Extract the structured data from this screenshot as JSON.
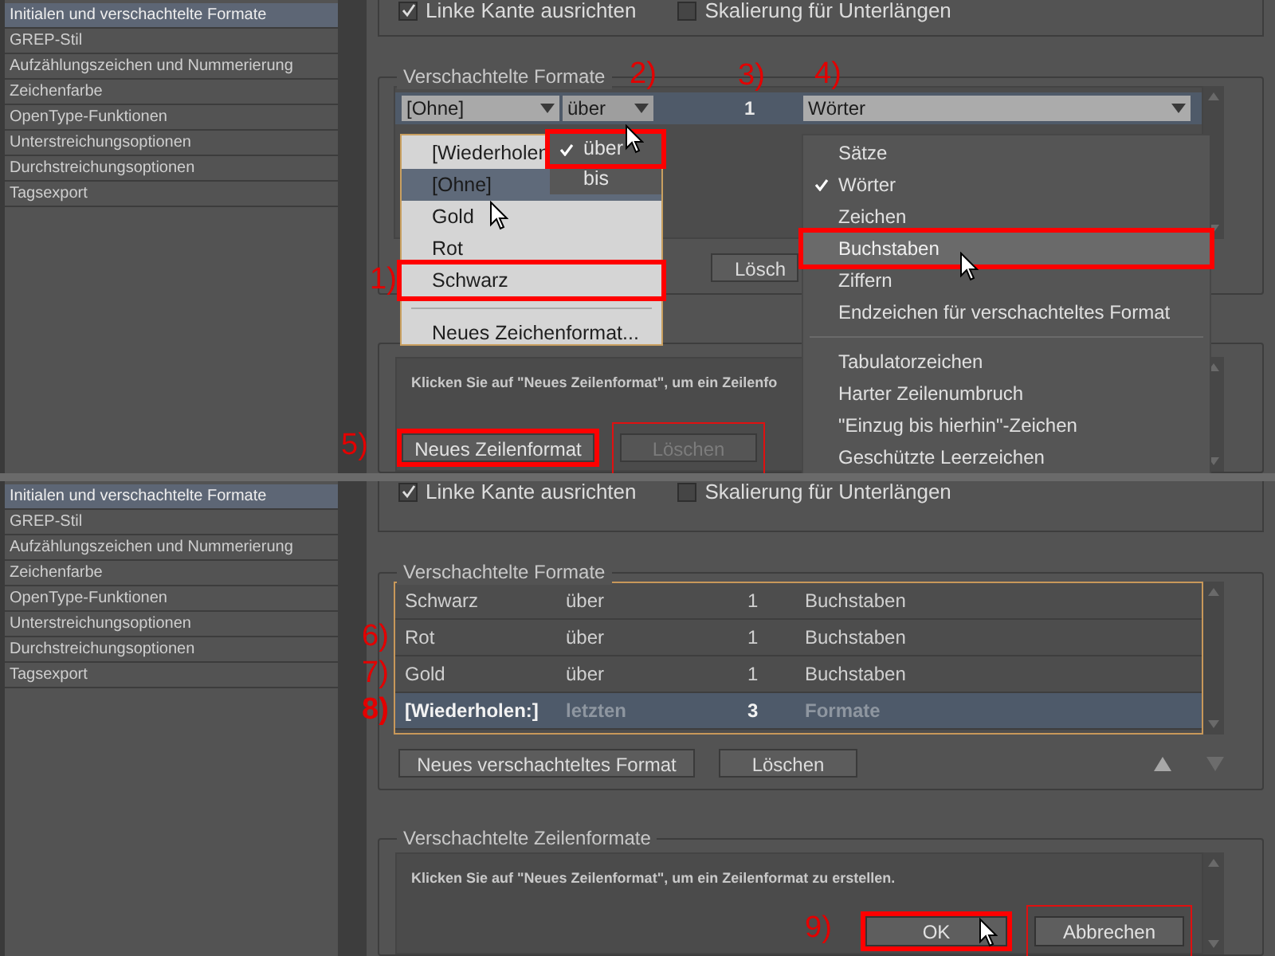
{
  "top_panel": {
    "sidebar": [
      {
        "label": "Initialen und verschachtelte Formate",
        "selected": true
      },
      {
        "label": "GREP-Stil",
        "selected": false
      },
      {
        "label": "Aufzählungszeichen und Nummerierung",
        "selected": false
      },
      {
        "label": "Zeichenfarbe",
        "selected": false
      },
      {
        "label": "OpenType-Funktionen",
        "selected": false
      },
      {
        "label": "Unterstreichungsoptionen",
        "selected": false
      },
      {
        "label": "Durchstreichungsoptionen",
        "selected": false
      },
      {
        "label": "Tagsexport",
        "selected": false
      }
    ],
    "options": [
      {
        "label": "Linke Kante ausrichten",
        "checked": true
      },
      {
        "label": "Skalierung für Unterlängen",
        "checked": false
      }
    ],
    "nested_styles": {
      "title": "Verschachtelte Formate",
      "row": [
        {
          "value": "[Ohne]",
          "kind": "select"
        },
        {
          "value": "über",
          "kind": "select",
          "annotation": "2)"
        },
        {
          "value": "1",
          "kind": "text",
          "annotation": "3)"
        },
        {
          "value": "Wörter",
          "kind": "select",
          "annotation": "4)"
        }
      ],
      "delete_button": "Lösch"
    },
    "line_styles": {
      "hint": "Klicken Sie auf \"Neues Zeilenformat\", um ein Zeilenfo",
      "buttons": [
        {
          "label": "Neues Zeilenformat",
          "disabled": false,
          "marked": true,
          "framed": false,
          "annotation": "5)"
        },
        {
          "label": "Löschen",
          "disabled": true,
          "marked": false,
          "framed": true
        }
      ]
    },
    "style_menu": {
      "items": [
        {
          "label": "[Wiederholen",
          "selected": false,
          "marked": false
        },
        {
          "label": "[Ohne]",
          "selected": true,
          "marked": false
        },
        {
          "label": "Gold",
          "selected": false,
          "marked": false
        },
        {
          "label": "Rot",
          "selected": false,
          "marked": false
        },
        {
          "label": "Schwarz",
          "selected": false,
          "marked": true,
          "annotation": "1)"
        }
      ],
      "footer": "Neues Zeichenformat..."
    },
    "mode_menu": [
      {
        "label": "über",
        "checked": true,
        "marked": true
      },
      {
        "label": "bis",
        "checked": false,
        "marked": false
      }
    ],
    "unit_menu": [
      {
        "kind": "item",
        "label": "Sätze",
        "checked": false,
        "selected": false,
        "marked": false
      },
      {
        "kind": "item",
        "label": "Wörter",
        "checked": true,
        "selected": false,
        "marked": false
      },
      {
        "kind": "item",
        "label": "Zeichen",
        "checked": false,
        "selected": false,
        "marked": false
      },
      {
        "kind": "item",
        "label": "Buchstaben",
        "checked": false,
        "selected": true,
        "marked": true
      },
      {
        "kind": "item",
        "label": "Ziffern",
        "checked": false,
        "selected": false,
        "marked": false
      },
      {
        "kind": "item",
        "label": "Endzeichen für verschachteltes Format",
        "checked": false,
        "selected": false,
        "marked": false
      },
      {
        "kind": "separator"
      },
      {
        "kind": "item",
        "label": "Tabulatorzeichen",
        "checked": false,
        "selected": false,
        "marked": false
      },
      {
        "kind": "item",
        "label": "Harter Zeilenumbruch",
        "checked": false,
        "selected": false,
        "marked": false
      },
      {
        "kind": "item",
        "label": "\"Einzug bis hierhin\"-Zeichen",
        "checked": false,
        "selected": false,
        "marked": false
      },
      {
        "kind": "item",
        "label": "Geschützte Leerzeichen",
        "checked": false,
        "selected": false,
        "marked": false
      }
    ]
  },
  "bottom_panel": {
    "sidebar": [
      {
        "label": "Initialen und verschachtelte Formate",
        "selected": true
      },
      {
        "label": "GREP-Stil",
        "selected": false
      },
      {
        "label": "Aufzählungszeichen und Nummerierung",
        "selected": false
      },
      {
        "label": "Zeichenfarbe",
        "selected": false
      },
      {
        "label": "OpenType-Funktionen",
        "selected": false
      },
      {
        "label": "Unterstreichungsoptionen",
        "selected": false
      },
      {
        "label": "Durchstreichungsoptionen",
        "selected": false
      },
      {
        "label": "Tagsexport",
        "selected": false
      }
    ],
    "options": [
      {
        "label": "Linke Kante ausrichten",
        "checked": true
      },
      {
        "label": "Skalierung für Unterlängen",
        "checked": false
      }
    ],
    "nested_styles": {
      "title": "Verschachtelte Formate",
      "rows": [
        {
          "style": "Schwarz",
          "mode": "über",
          "count": "1",
          "unit": "Buchstaben",
          "selected": false
        },
        {
          "style": "Rot",
          "mode": "über",
          "count": "1",
          "unit": "Buchstaben",
          "selected": false,
          "annotation": "6)"
        },
        {
          "style": "Gold",
          "mode": "über",
          "count": "1",
          "unit": "Buchstaben",
          "selected": false,
          "annotation": "7)"
        },
        {
          "style": "[Wiederholen:]",
          "mode": "letzten",
          "count": "3",
          "unit": "Formate",
          "selected": true,
          "annotation": "8)"
        }
      ],
      "buttons": [
        "Neues verschachteltes Format",
        "Löschen"
      ]
    },
    "line_styles": {
      "title": "Verschachtelte Zeilenformate",
      "hint": "Klicken Sie auf \"Neues Zeilenformat\", um ein Zeilenformat zu erstellen.",
      "dialog_buttons": [
        {
          "label": "OK",
          "marked": true,
          "framed": false,
          "annotation": "9)"
        },
        {
          "label": "Abbrechen",
          "marked": false,
          "framed": true
        }
      ]
    }
  }
}
